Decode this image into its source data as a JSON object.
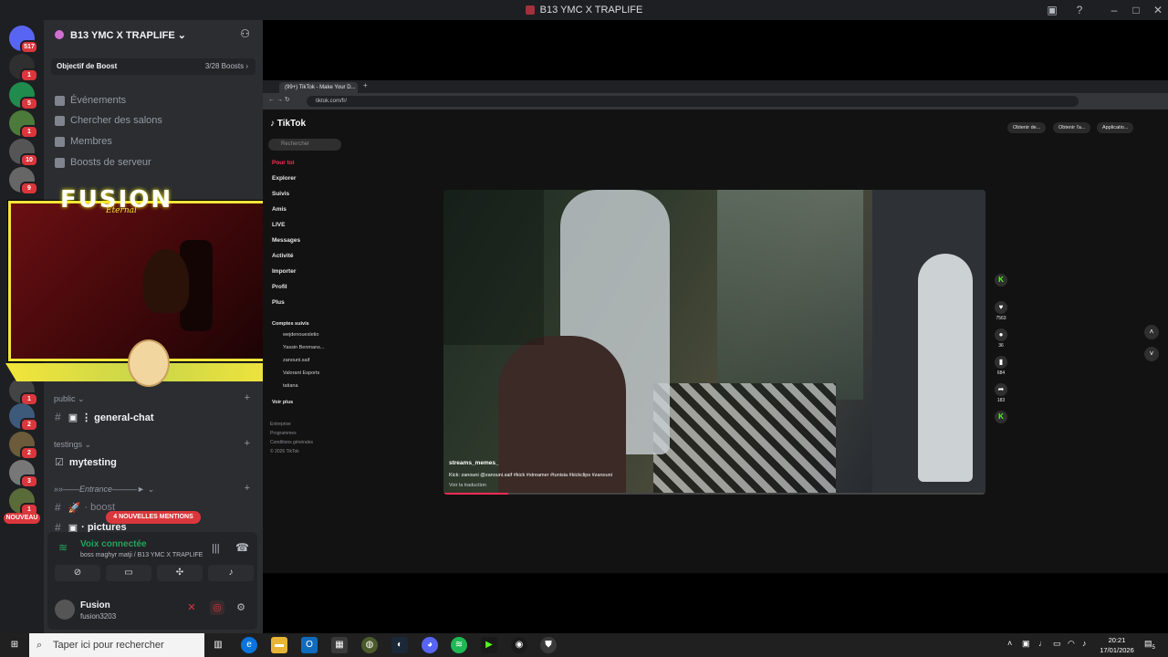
{
  "window": {
    "title": "B13 YMC X TRAPLIFE"
  },
  "server": {
    "name": "B13 YMC X TRAPLIFE",
    "boost_goal_label": "Objectif de Boost",
    "boost_count": "3/28 Boosts"
  },
  "guilds": {
    "badges": [
      "517",
      "1",
      "5",
      "1",
      "10",
      "9",
      "1",
      "2",
      "2",
      "3",
      "1"
    ],
    "nouveau": "NOUVEAU"
  },
  "nav": {
    "events": "Événements",
    "browse": "Chercher des salons",
    "members": "Membres",
    "boosts": "Boosts de serveur"
  },
  "categories": {
    "public": "public",
    "testings": "testings",
    "entrance": "»»——Entrance———►"
  },
  "channels": {
    "general": "⋮ general-chat",
    "mytesting": "mytesting",
    "boost": "· boost",
    "pictures": "· pictures"
  },
  "mentions": "4 NOUVELLES MENTIONS",
  "voice": {
    "status": "Voix connectée",
    "location": "boss maghyr matji / B13 YMC X TRAPLIFE"
  },
  "user": {
    "name": "Fusion",
    "tag": "fusion3203"
  },
  "stream_overlay": {
    "title": "FUSION",
    "subtitle": "Eternal"
  },
  "browser": {
    "tab_title": "(99+) TikTok - Make Your D...",
    "url": "tiktok.com/fr/"
  },
  "tiktok": {
    "logo": "TikTok",
    "search_placeholder": "Rechercher",
    "nav": [
      "Pour toi",
      "Explorer",
      "Suivis",
      "Amis",
      "LIVE",
      "Messages",
      "Activité",
      "Importer",
      "Profil",
      "Plus"
    ],
    "following_header": "Comptes suivis",
    "following": [
      "wejdenouesletio",
      "Yassin Benmans...",
      "zanouni.saif",
      "Valorant Esports",
      "tatiana"
    ],
    "see_more": "Voir plus",
    "footer": [
      "Entreprise",
      "Programmes",
      "Conditions générales",
      "© 2026 TikTok"
    ],
    "top_buttons": [
      "Obtenir de...",
      "Obtenir l'a...",
      "Applicatio..."
    ],
    "video": {
      "username": "streams_memes_",
      "caption": "Kick: zanouni @zanouni.saif #kick #streamer #tunisia #kickclips #zanouni",
      "translate": "Voir la traduction",
      "progress": 0.12
    },
    "actions": {
      "likes": "7563",
      "comments": "36",
      "saves": "684",
      "shares": "183"
    }
  },
  "taskbar": {
    "search_placeholder": "Taper ici pour rechercher",
    "time": "20:21",
    "date": "17/01/2026",
    "notif_count": "5"
  }
}
